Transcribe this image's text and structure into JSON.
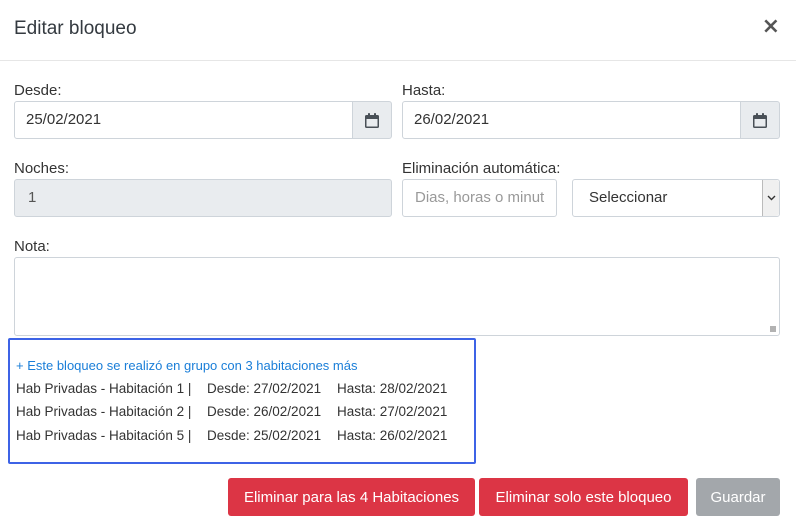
{
  "modal": {
    "title": "Editar bloqueo",
    "close_glyph": "×"
  },
  "form": {
    "desde_label": "Desde:",
    "desde_value": "25/02/2021",
    "hasta_label": "Hasta:",
    "hasta_value": "26/02/2021",
    "noches_label": "Noches:",
    "noches_value": "1",
    "eliminacion_label": "Eliminación automática:",
    "eliminacion_placeholder": "Dias, horas o minut",
    "select_value": "Seleccionar",
    "nota_label": "Nota:"
  },
  "group": {
    "link_text": "+ Este bloqueo se realizó en grupo con 3 habitaciones más",
    "rows": [
      {
        "room": "Hab Privadas - Habitación 1 |",
        "desde": "Desde: 27/02/2021",
        "hasta": "Hasta: 28/02/2021"
      },
      {
        "room": "Hab Privadas - Habitación 2 |",
        "desde": "Desde: 26/02/2021",
        "hasta": "Hasta: 27/02/2021"
      },
      {
        "room": "Hab Privadas - Habitación 5 |",
        "desde": "Desde: 25/02/2021",
        "hasta": "Hasta: 26/02/2021"
      }
    ]
  },
  "footer": {
    "delete_all_label": "Eliminar para las 4 Habitaciones",
    "delete_one_label": "Eliminar solo este bloqueo",
    "save_label": "Guardar"
  },
  "colors": {
    "danger": "#dc3545",
    "disabled_button": "#a3a7ab",
    "link": "#1a7ed8",
    "highlight_border": "#3d63e6"
  },
  "icons": {
    "date_picker": "calendar-icon",
    "close": "close-icon",
    "select_arrow": "chevron-down-icon"
  }
}
